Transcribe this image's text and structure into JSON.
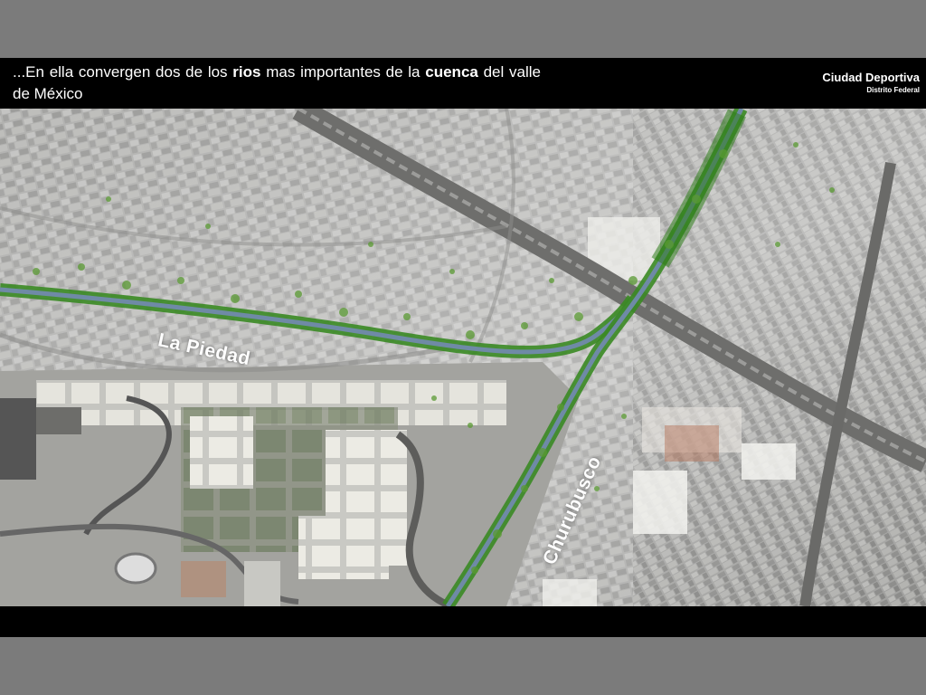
{
  "caption": {
    "part1": "...En ella convergen dos de los ",
    "bold1": "rios",
    "part2": " mas importantes de la ",
    "bold2": "cuenca",
    "part3": " del valle de México"
  },
  "brand": {
    "title": "Ciudad Deportiva",
    "subtitle": "Distrito Federal"
  },
  "map": {
    "labels": {
      "river_west": "La Piedad",
      "river_south": "Churubusco"
    },
    "colors": {
      "river_green": "#3a8a24",
      "water_blue": "#6f8aa6",
      "urban_gray": "#9a9a9a",
      "sports_field": "#e6e4dc"
    }
  }
}
